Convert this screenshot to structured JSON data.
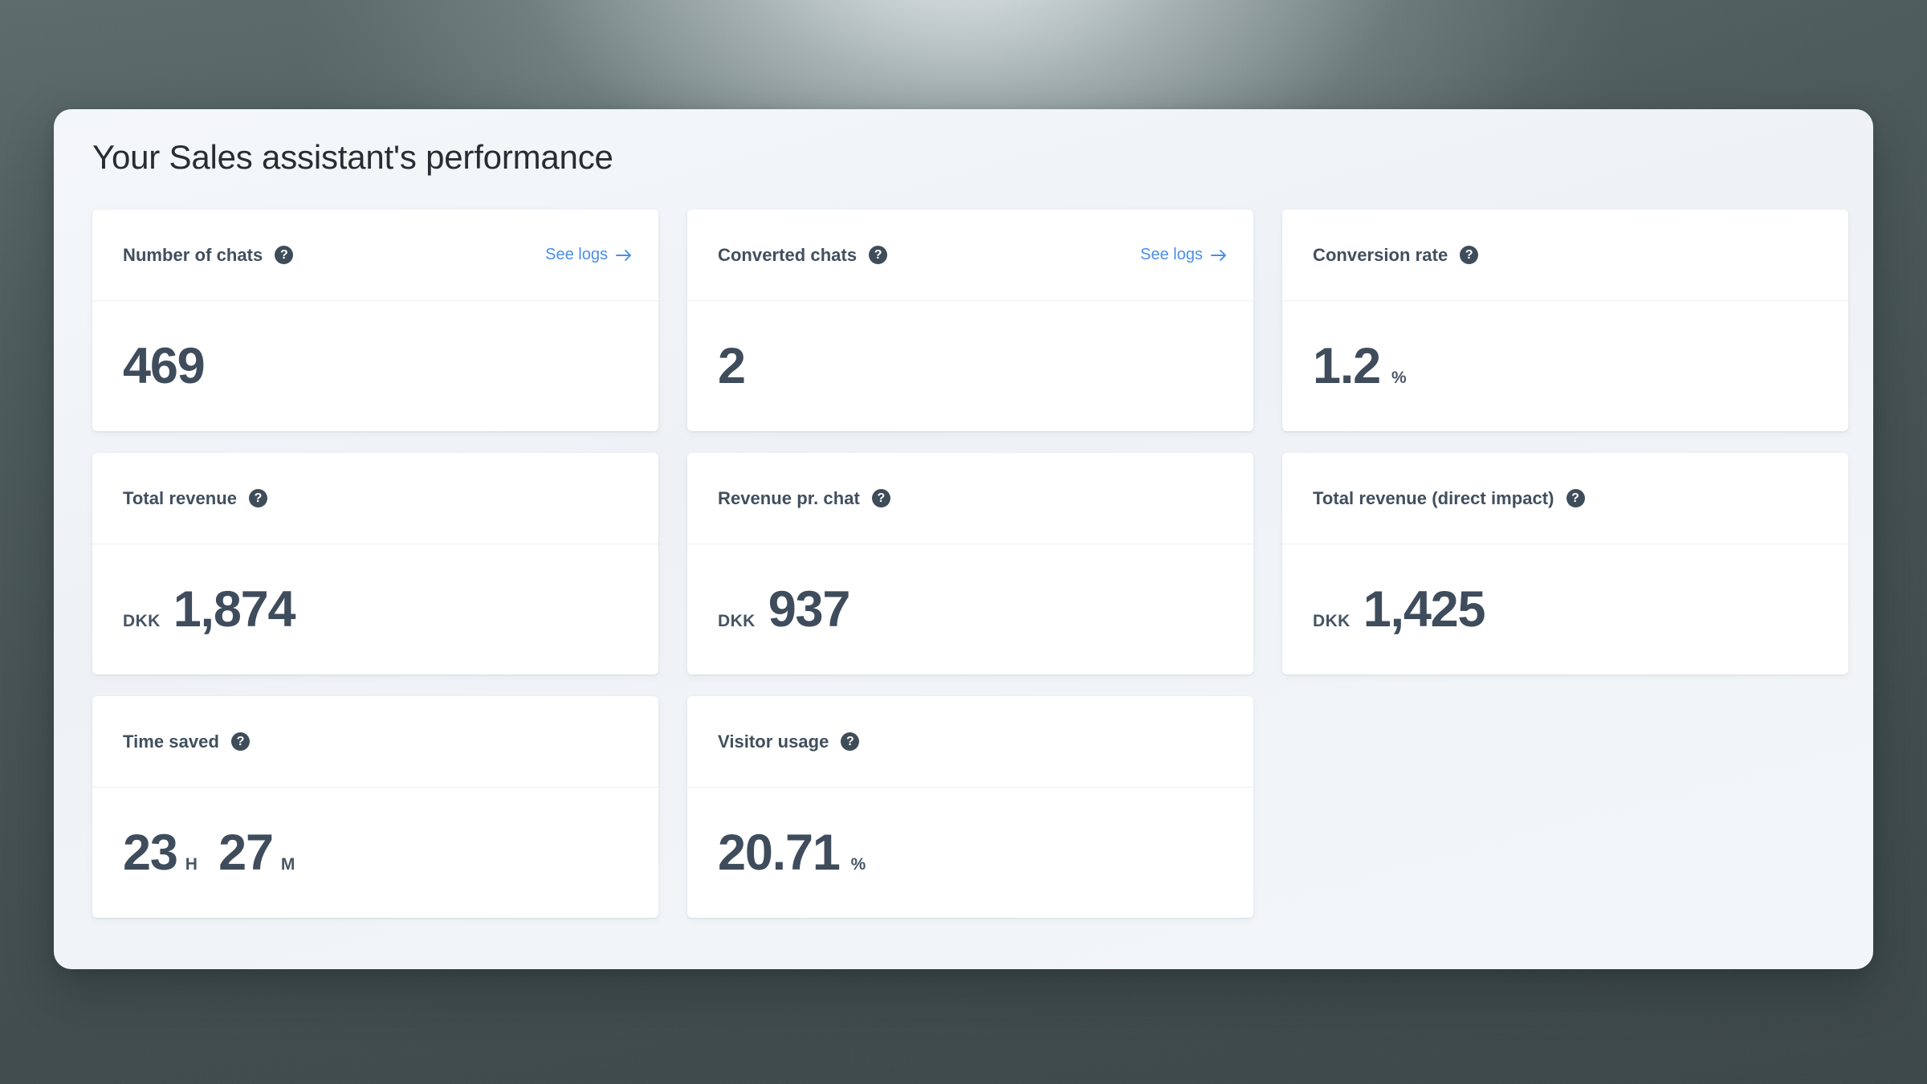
{
  "panel": {
    "title": "Your Sales assistant's performance"
  },
  "theme": {
    "backdrop": "#434f50",
    "panel_bg": "#f1f5f8",
    "card_bg": "#ffffff",
    "label_color": "#414f5e",
    "value_color": "#3e4c5c",
    "link_color": "#4a8ee8",
    "help_icon_bg": "#3f4c5a"
  },
  "icons": {
    "help": "help-circle-icon",
    "arrow_right": "arrow-right-icon",
    "help_glyph": "?"
  },
  "cards": [
    {
      "label": "Number of chats",
      "help": "?",
      "link": "See logs",
      "prefix": "",
      "value": "469",
      "unit": ""
    },
    {
      "label": "Converted chats",
      "help": "?",
      "link": "See logs",
      "prefix": "",
      "value": "2",
      "unit": ""
    },
    {
      "label": "Conversion rate",
      "help": "?",
      "link": "",
      "prefix": "",
      "value": "1.2",
      "unit": "%"
    },
    {
      "label": "Total revenue",
      "help": "?",
      "link": "",
      "prefix": "DKK",
      "value": "1,874",
      "unit": ""
    },
    {
      "label": "Revenue pr. chat",
      "help": "?",
      "link": "",
      "prefix": "DKK",
      "value": "937",
      "unit": ""
    },
    {
      "label": "Total revenue (direct impact)",
      "help": "?",
      "link": "",
      "prefix": "DKK",
      "value": "1,425",
      "unit": ""
    },
    {
      "label": "Time saved",
      "help": "?",
      "link": "",
      "prefix": "",
      "value": "23",
      "unit": "H",
      "value2": "27",
      "unit2": "M"
    },
    {
      "label": "Visitor usage",
      "help": "?",
      "link": "",
      "prefix": "",
      "value": "20.71",
      "unit": "%"
    }
  ]
}
